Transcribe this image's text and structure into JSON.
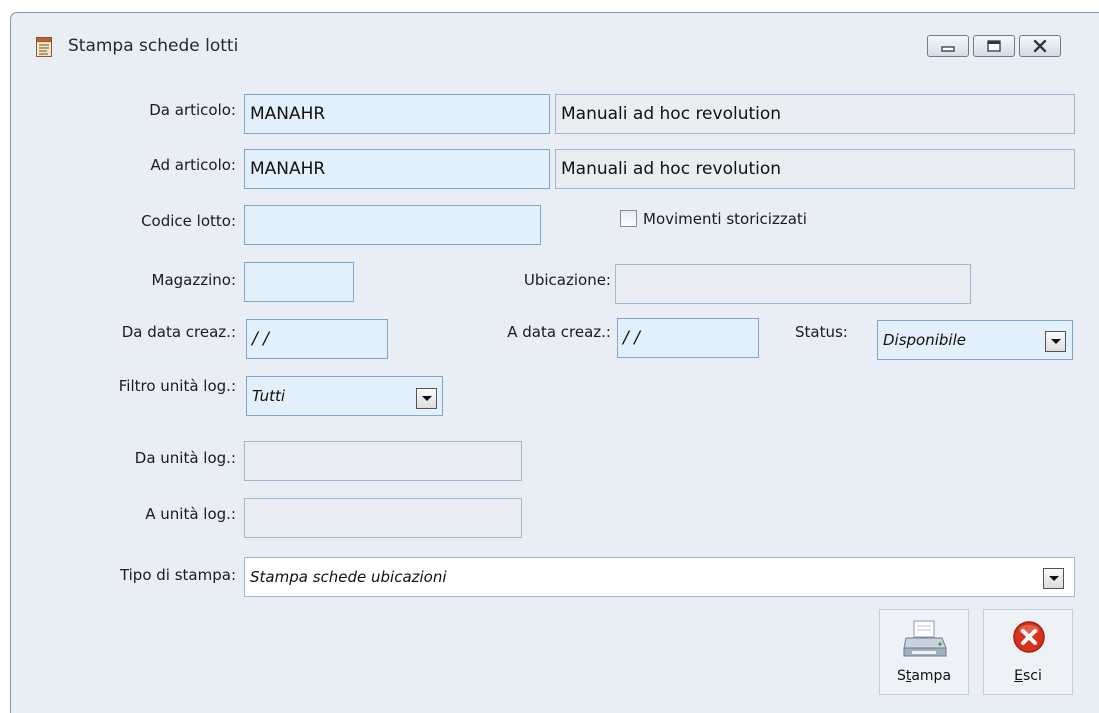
{
  "window": {
    "title": "Stampa schede lotti",
    "icons": {
      "app": "document-icon",
      "minimize": "minimize-icon",
      "maximize": "maximize-icon",
      "close": "close-icon"
    }
  },
  "form": {
    "da_articolo": {
      "label": "Da articolo:",
      "code": "MANAHR",
      "description": "Manuali ad hoc revolution"
    },
    "ad_articolo": {
      "label": "Ad articolo:",
      "code": "MANAHR",
      "description": "Manuali ad hoc revolution"
    },
    "codice_lotto": {
      "label": "Codice lotto:",
      "value": ""
    },
    "movimenti_storicizzati": {
      "label": "Movimenti storicizzati",
      "checked": false
    },
    "magazzino": {
      "label": "Magazzino:",
      "value": ""
    },
    "ubicazione": {
      "label": "Ubicazione:",
      "value": ""
    },
    "da_data_creaz": {
      "label": "Da data creaz.:",
      "value": " /  /"
    },
    "a_data_creaz": {
      "label": "A data creaz.:",
      "value": " /  /"
    },
    "status": {
      "label": "Status:",
      "value": "Disponibile"
    },
    "filtro_unita_log": {
      "label": "Filtro unità log.:",
      "value": "Tutti"
    },
    "da_unita_log": {
      "label": "Da unità log.:",
      "value": ""
    },
    "a_unita_log": {
      "label": "A unità log.:",
      "value": ""
    },
    "tipo_di_stampa": {
      "label": "Tipo di stampa:",
      "value": "Stampa schede ubicazioni"
    }
  },
  "buttons": {
    "stampa": {
      "mnemonic_prefix": "S",
      "mnemonic": "t",
      "rest": "ampa",
      "icon": "printer-icon"
    },
    "esci": {
      "mnemonic_prefix": "",
      "mnemonic": "E",
      "rest": "sci",
      "icon": "close-circle-icon"
    }
  },
  "colors": {
    "window_bg": "#e9eef4",
    "field_bg": "#e1f0fb",
    "field_border": "#7ea6cf",
    "exit_red": "#d8321f"
  }
}
